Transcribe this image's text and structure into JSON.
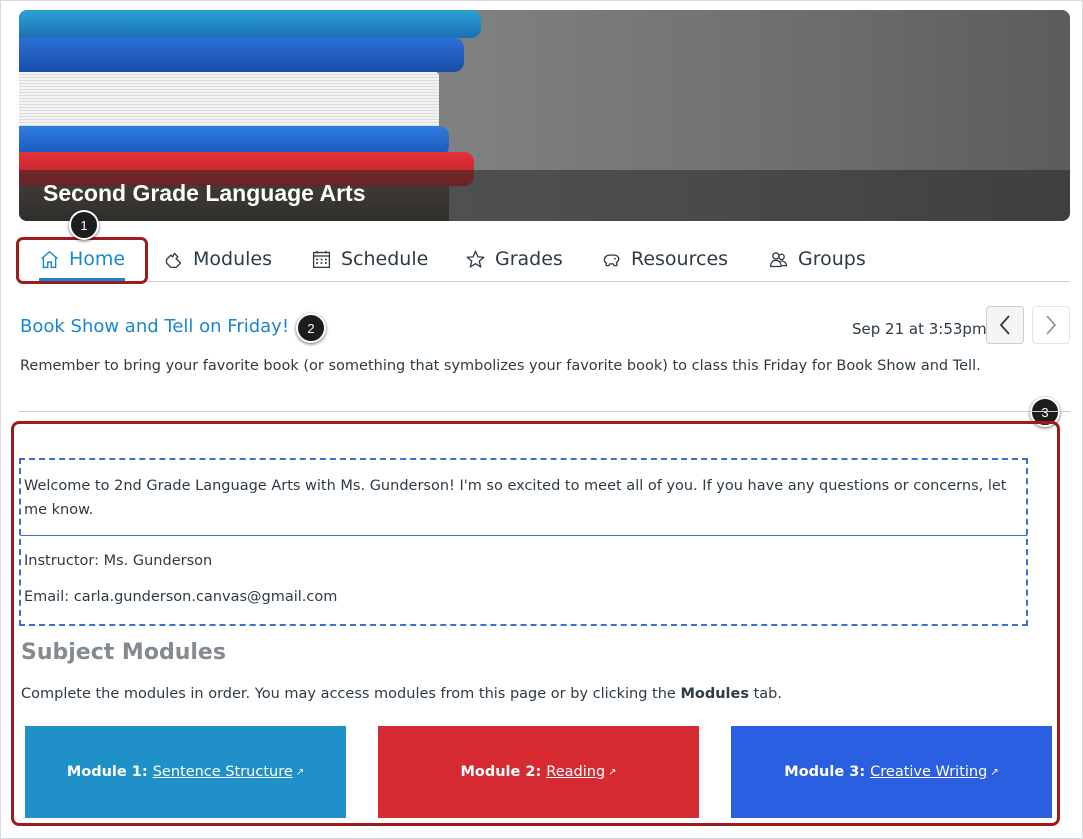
{
  "course": {
    "title": "Second Grade Language Arts"
  },
  "callouts": [
    "1",
    "2",
    "3"
  ],
  "tabs": [
    {
      "label": "Home",
      "icon": "home-icon",
      "active": true
    },
    {
      "label": "Modules",
      "icon": "modules-icon"
    },
    {
      "label": "Schedule",
      "icon": "calendar-icon"
    },
    {
      "label": "Grades",
      "icon": "star-icon"
    },
    {
      "label": "Resources",
      "icon": "resources-icon"
    },
    {
      "label": "Groups",
      "icon": "groups-icon"
    }
  ],
  "announcement": {
    "title": "Book Show and Tell on Friday!",
    "date": "Sep 21 at 3:53pm",
    "body": "Remember to bring your favorite book (or something that symbolizes your favorite book) to class this Friday for Book Show and Tell."
  },
  "front_page": {
    "welcome": "Welcome to 2nd Grade Language Arts with Ms. Gunderson! I'm so excited to meet all of you. If you have any questions or concerns, let me know.",
    "instructor": "Instructor: Ms. Gunderson",
    "email": "Email: carla.gunderson.canvas@gmail.com",
    "subject_title": "Subject Modules",
    "subject_desc_prefix": "Complete the modules in order. You may access modules from this page or by clicking the ",
    "subject_desc_bold": "Modules",
    "subject_desc_suffix": " tab.",
    "modules": [
      {
        "prefix": "Module 1:",
        "link": "Sentence Structure",
        "color": "#1f90c8"
      },
      {
        "prefix": "Module 2:",
        "link": "Reading",
        "color": "#d62a33"
      },
      {
        "prefix": "Module 3:",
        "link": "Creative Writing",
        "color": "#2b5fe2"
      }
    ]
  },
  "colors": {
    "accent": "#1a86d0",
    "highlight_border": "#9b1b1f"
  }
}
